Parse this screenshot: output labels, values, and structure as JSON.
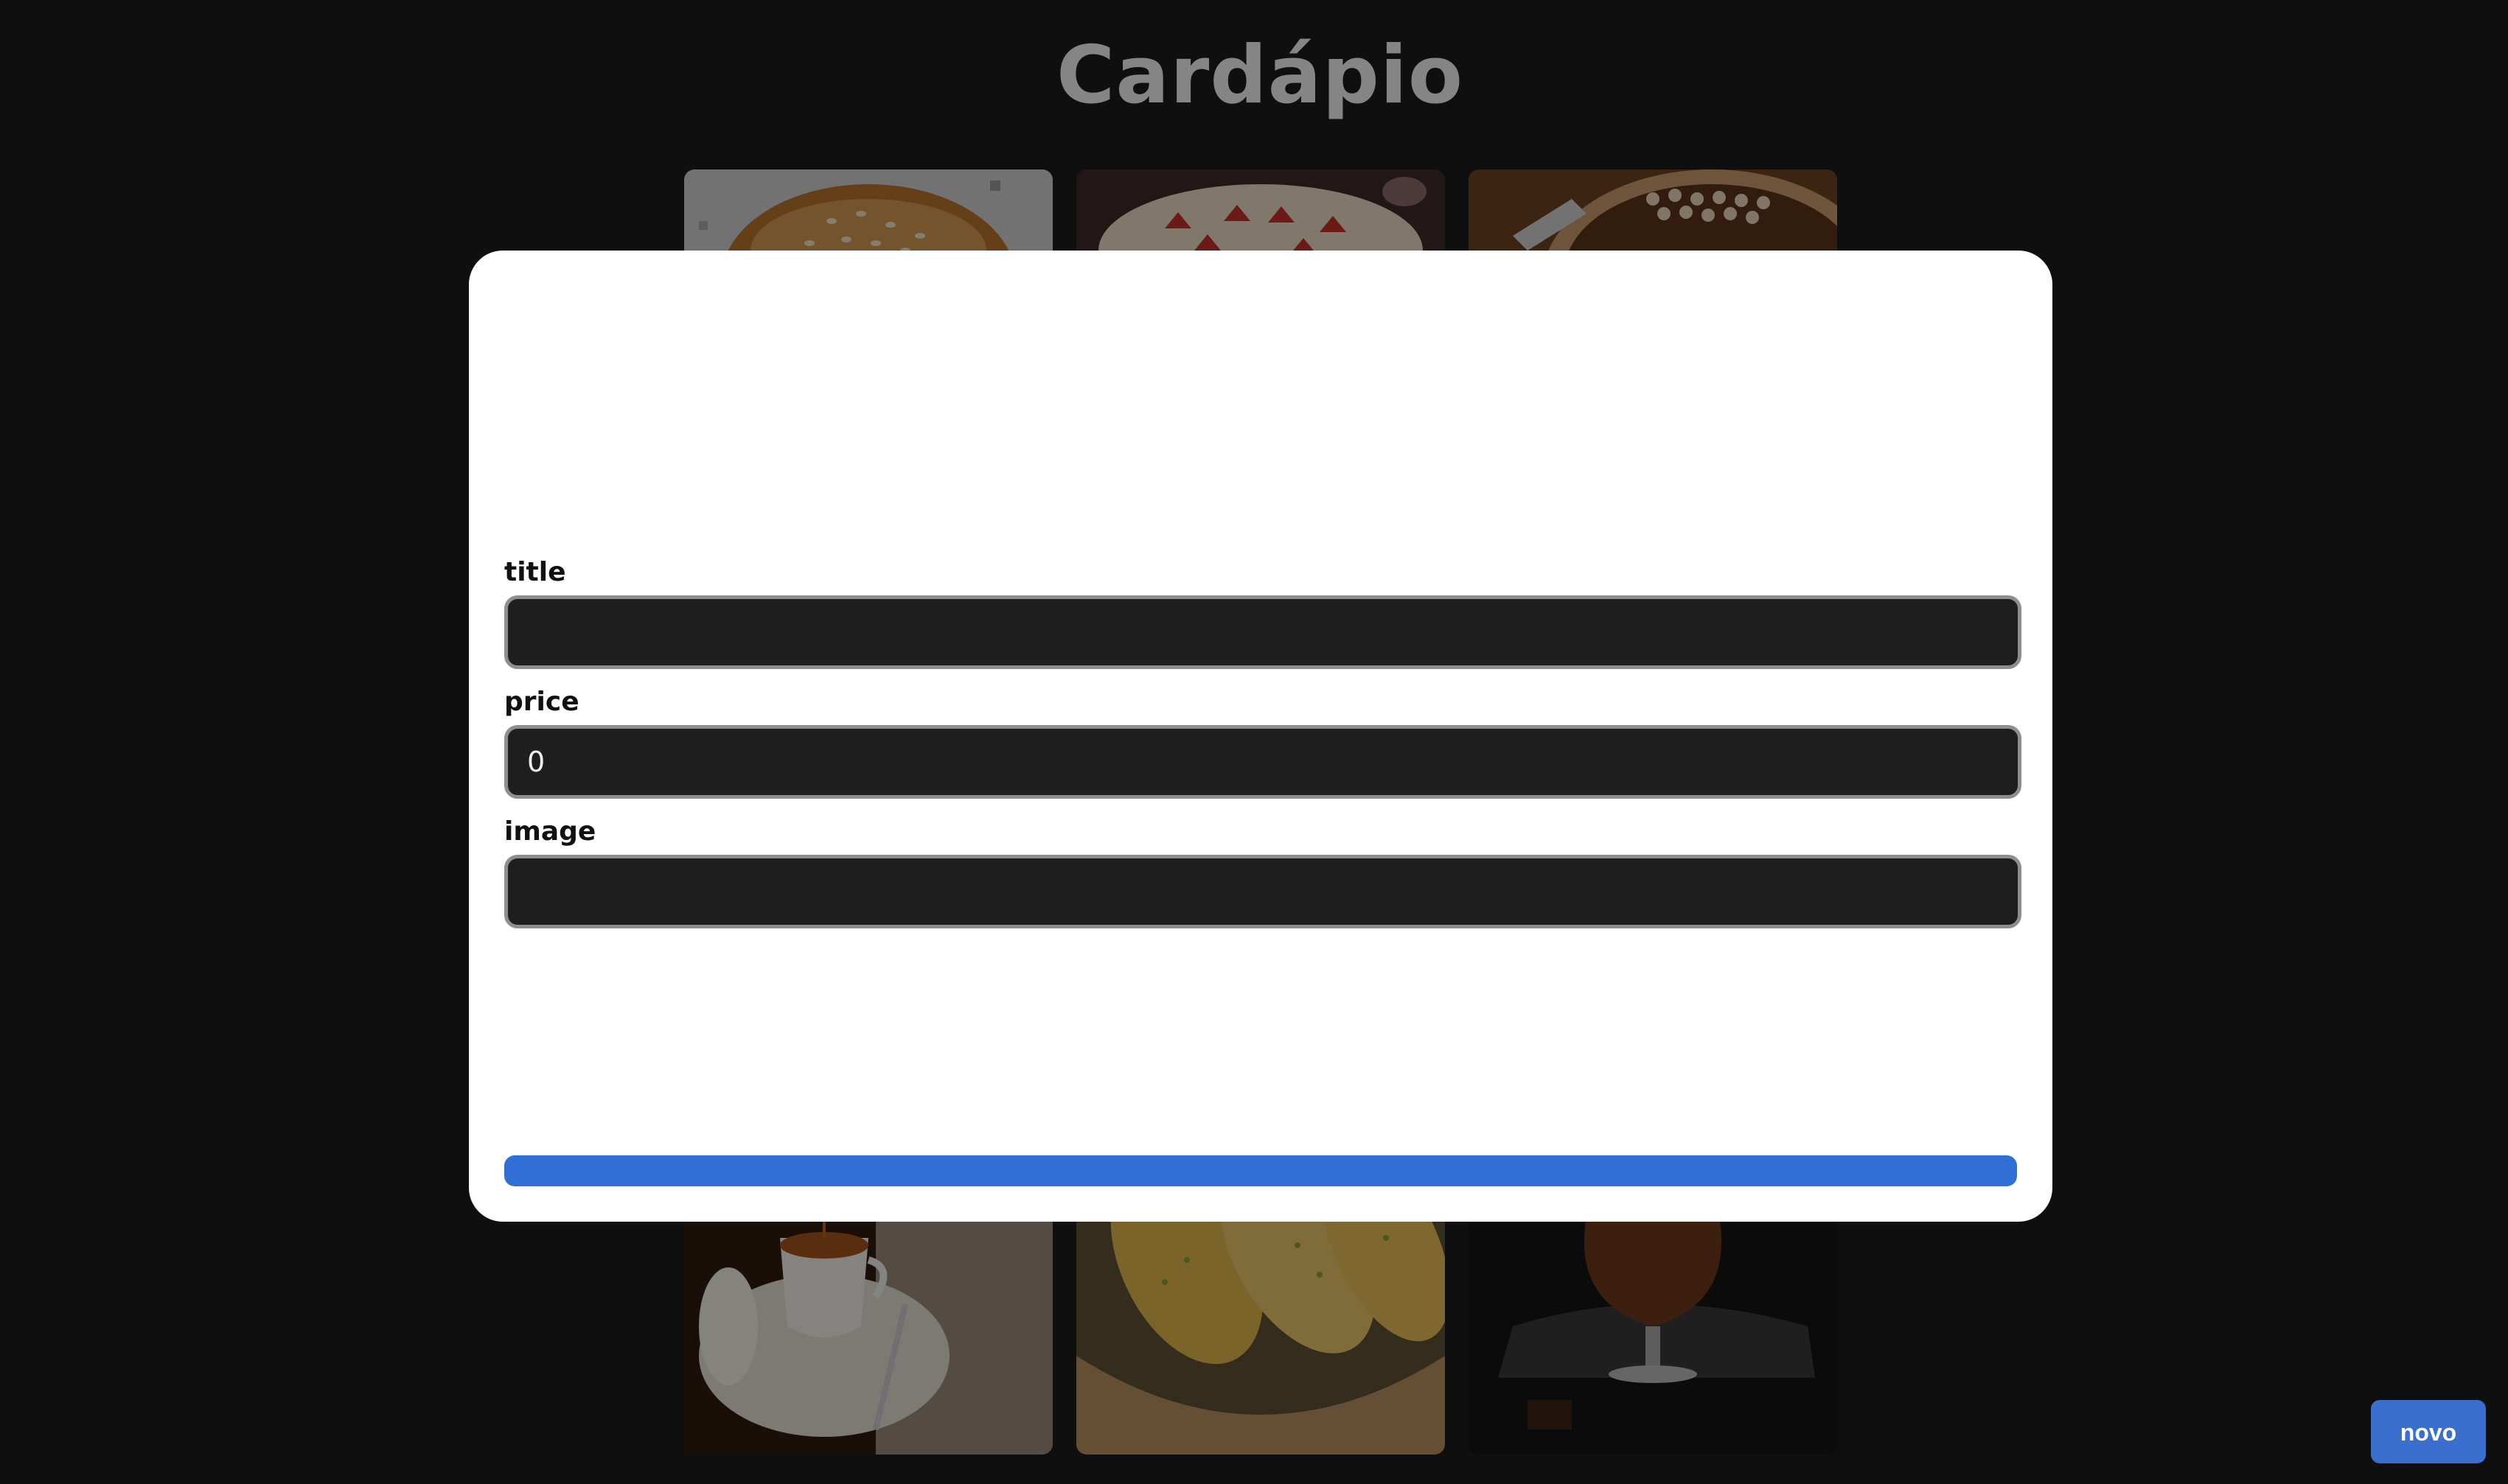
{
  "page": {
    "title": "Cardápio"
  },
  "menu": {
    "items": [
      {
        "image": "burger-bun",
        "colors": [
          "#c9c9c9",
          "#b7762f",
          "#e2b070"
        ]
      },
      {
        "image": "strawberry-cake",
        "colors": [
          "#3a2a28",
          "#e8d8c0",
          "#c0302a"
        ]
      },
      {
        "image": "coconut-pie",
        "colors": [
          "#7a4a22",
          "#cda57c",
          "#4a2a14"
        ]
      },
      {
        "image": "tea-cup",
        "colors": [
          "#3a2616",
          "#e8e4dc",
          "#a8561a"
        ]
      },
      {
        "image": "garlic-bread",
        "colors": [
          "#6a5a3a",
          "#e0b855",
          "#b89060"
        ]
      },
      {
        "image": "chocolate-dessert",
        "colors": [
          "#1a1a1a",
          "#6a3a1e",
          "#9a6a44"
        ]
      }
    ]
  },
  "form": {
    "title_label": "title",
    "title_value": "",
    "price_label": "price",
    "price_value": "0",
    "image_label": "image",
    "image_value": ""
  },
  "actions": {
    "new_label": "novo"
  },
  "colors": {
    "background": "#1c1c1c",
    "modal": "#ffffff",
    "input_bg": "#1e1e1e",
    "primary": "#2f6fd6"
  }
}
